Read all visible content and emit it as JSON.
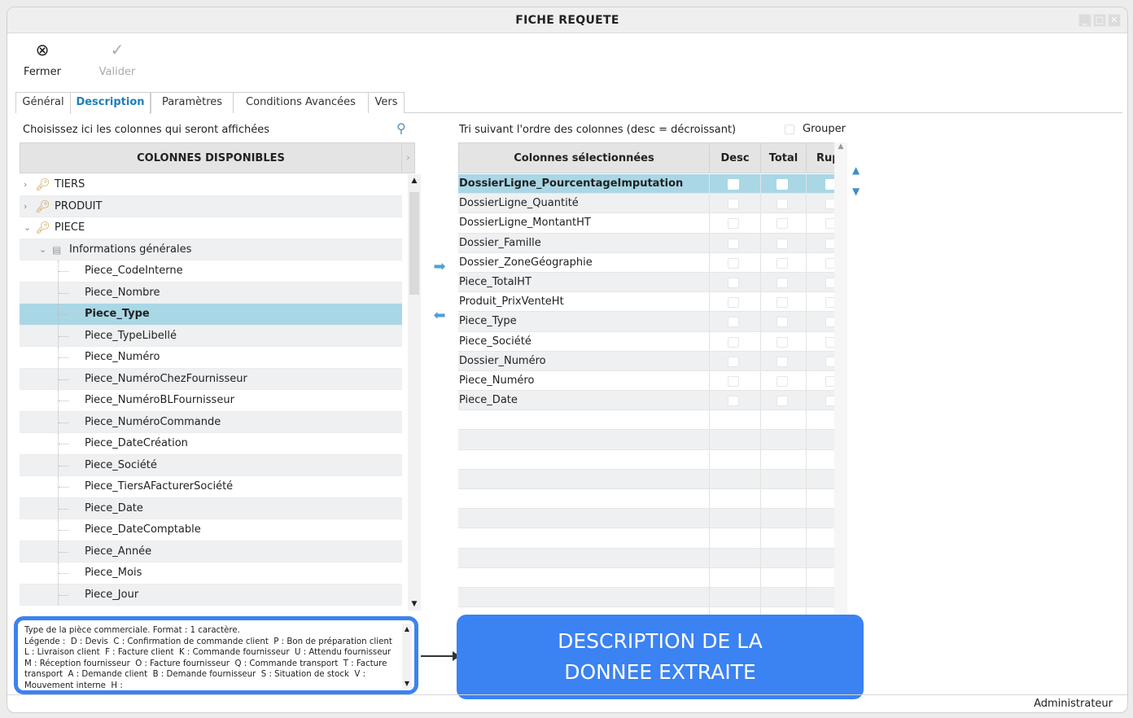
{
  "window": {
    "title": "FICHE REQUETE",
    "controls": [
      "_",
      "□",
      "✕"
    ]
  },
  "toolbar": {
    "close_label": "Fermer",
    "close_icon": "⊗",
    "validate_label": "Valider",
    "validate_icon": "✓"
  },
  "tabs": [
    "Général",
    "Description",
    "Paramètres",
    "Conditions Avancées",
    "Vers"
  ],
  "left": {
    "hint": "Choisissez ici les colonnes qui seront affichées",
    "header": "COLONNES DISPONIBLES",
    "header_arrow": "›",
    "tree": [
      {
        "label": "TIERS",
        "level": 0,
        "chevron": "›"
      },
      {
        "label": "PRODUIT",
        "level": 0,
        "chevron": "›"
      },
      {
        "label": "PIECE",
        "level": 0,
        "chevron": "⌄"
      },
      {
        "label": "Informations générales",
        "level": 1,
        "chevron": "⌄"
      },
      {
        "label": "Piece_CodeInterne",
        "level": 2
      },
      {
        "label": "Piece_Nombre",
        "level": 2
      },
      {
        "label": "Piece_Type",
        "level": 2,
        "selected": true
      },
      {
        "label": "Piece_TypeLibellé",
        "level": 2
      },
      {
        "label": "Piece_Numéro",
        "level": 2
      },
      {
        "label": "Piece_NuméroChezFournisseur",
        "level": 2
      },
      {
        "label": "Piece_NuméroBLFournisseur",
        "level": 2
      },
      {
        "label": "Piece_NuméroCommande",
        "level": 2
      },
      {
        "label": "Piece_DateCréation",
        "level": 2
      },
      {
        "label": "Piece_Société",
        "level": 2
      },
      {
        "label": "Piece_TiersAFacturerSociété",
        "level": 2
      },
      {
        "label": "Piece_Date",
        "level": 2
      },
      {
        "label": "Piece_DateComptable",
        "level": 2
      },
      {
        "label": "Piece_Année",
        "level": 2
      },
      {
        "label": "Piece_Mois",
        "level": 2
      },
      {
        "label": "Piece_Jour",
        "level": 2
      }
    ]
  },
  "move": {
    "add_icon": "➡",
    "remove_icon": "⬅"
  },
  "right": {
    "sort_label": "Tri suivant l'ordre des colonnes (desc = décroissant)",
    "group_label": "Grouper",
    "columns": [
      "Colonnes sélectionnées",
      "Desc",
      "Total",
      "Rupt"
    ],
    "rows": [
      {
        "name": "DossierLigne_PourcentageImputation",
        "selected": true
      },
      {
        "name": "DossierLigne_Quantité"
      },
      {
        "name": "DossierLigne_MontantHT"
      },
      {
        "name": "Dossier_Famille"
      },
      {
        "name": "Dossier_ZoneGéographie"
      },
      {
        "name": "Piece_TotalHT"
      },
      {
        "name": "Produit_PrixVenteHt"
      },
      {
        "name": "Piece_Type"
      },
      {
        "name": "Piece_Société"
      },
      {
        "name": "Dossier_Numéro"
      },
      {
        "name": "Piece_Numéro"
      },
      {
        "name": "Piece_Date"
      }
    ],
    "empty_rows": 11,
    "up_icon": "▲",
    "down_icon": "▼"
  },
  "description": {
    "text": "Type de la pièce commerciale. Format : 1 caractère.\nLégende :  D : Devis  C : Confirmation de commande client  P : Bon de préparation client  L : Livraison client  F : Facture client  K : Commande fournisseur  U : Attendu fournisseur  M : Réception fournisseur  O : Facture fournisseur  Q : Commande transport  T : Facture transport  A : Demande client  B : Demande fournisseur  S : Situation de stock  V : Mouvement interne  H :"
  },
  "callout": {
    "line1": "DESCRIPTION DE LA",
    "line2": "DONNEE EXTRAITE"
  },
  "status": {
    "user": "Administrateur"
  }
}
